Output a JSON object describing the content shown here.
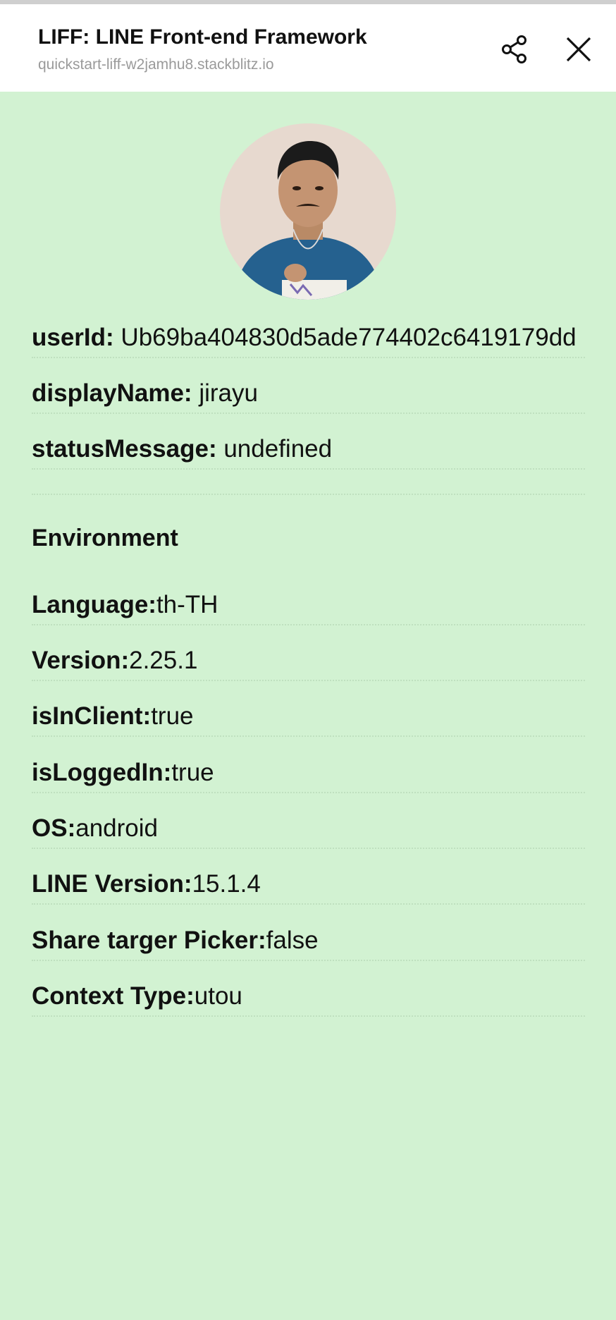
{
  "header": {
    "title": "LIFF: LINE Front-end Framework",
    "url": "quickstart-liff-w2jamhu8.stackblitz.io",
    "share_icon": "share-icon",
    "close_icon": "close-icon"
  },
  "profile": {
    "avatar_icon": "profile-photo",
    "fields": [
      {
        "label": "userId:",
        "value": " Ub69ba404830d5ade774402c6419179dd"
      },
      {
        "label": "displayName:",
        "value": " jirayu"
      },
      {
        "label": "statusMessage:",
        "value": " undefined"
      }
    ]
  },
  "environment": {
    "title": "Environment",
    "fields": [
      {
        "label": "Language:",
        "value": "th-TH"
      },
      {
        "label": "Version:",
        "value": "2.25.1"
      },
      {
        "label": "isInClient:",
        "value": "true"
      },
      {
        "label": "isLoggedIn:",
        "value": "true"
      },
      {
        "label": "OS:",
        "value": "android"
      },
      {
        "label": "LINE Version:",
        "value": "15.1.4"
      },
      {
        "label": "Share targer Picker:",
        "value": "false"
      },
      {
        "label": "Context Type:",
        "value": "utou"
      }
    ]
  },
  "colors": {
    "background": "#d2f2d2",
    "header_background": "#ffffff",
    "url_text": "#9a9a9a"
  }
}
